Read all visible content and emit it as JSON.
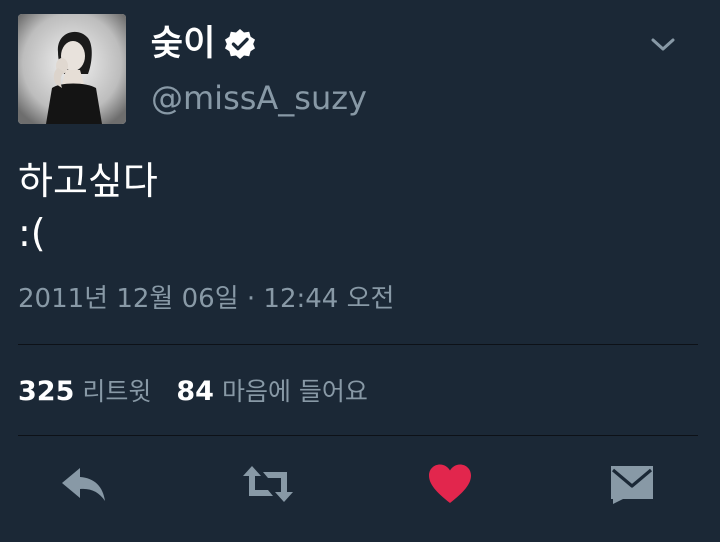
{
  "profile": {
    "display_name": "숮이",
    "handle": "@missA_suzy",
    "verified": true
  },
  "tweet": {
    "line1": "하고싶다",
    "line2": ":("
  },
  "timestamp": "2011년 12월 06일 · 12:44 오전",
  "stats": {
    "retweets_count": "325",
    "retweets_label": "리트윗",
    "likes_count": "84",
    "likes_label": "마음에 들어요"
  },
  "actions": [
    {
      "icon": "reply-icon"
    },
    {
      "icon": "retweet-icon"
    },
    {
      "icon": "heart-icon",
      "active": true
    },
    {
      "icon": "direct-message-icon"
    }
  ],
  "colors": {
    "background": "#1b2836",
    "primary_text": "#ffffff",
    "secondary_text": "#8899a6",
    "like_active": "#e2264d",
    "divider": "#0d1117"
  }
}
